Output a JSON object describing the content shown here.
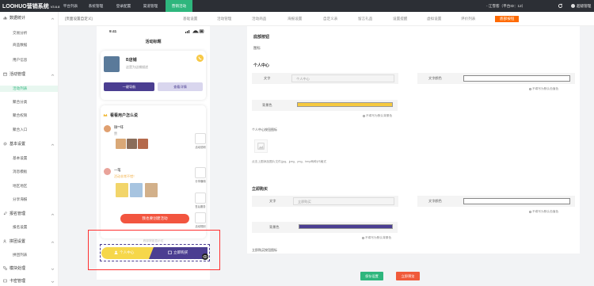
{
  "app": {
    "name": "LOOHUO营销系统",
    "version": "V3.6.8"
  },
  "topbar": {
    "nav": [
      "平台列表",
      "系统管理",
      "登录配置",
      "渠道管理",
      "营销活动"
    ],
    "merchant": "- 江雪客（平台ID：12）",
    "account": "超级管理"
  },
  "sidebar": {
    "groups": [
      {
        "label": "数据统计",
        "items": [
          "交易分析",
          "商品数据",
          "用户信息"
        ]
      },
      {
        "label": "活动管理",
        "items": [
          "活动列表",
          "聚合分类",
          "聚合权限",
          "聚合入口"
        ]
      },
      {
        "label": "基本设置",
        "items": [
          "基本设置",
          "消息模板",
          "地区地区",
          "分享海报"
        ]
      },
      {
        "label": "报名管理",
        "items": [
          "报名设置"
        ]
      },
      {
        "label": "拼团设置",
        "items": [
          "拼团列表"
        ]
      },
      {
        "label": "模块处理",
        "items": []
      },
      {
        "label": "卡密管理",
        "items": []
      }
    ],
    "active_item": "活动列表"
  },
  "tabs": [
    "[页面设置自定义]",
    "基础设置",
    "活动管理",
    "活动商品",
    "海报设置",
    "自定义表",
    "留言礼品",
    "设置提醒",
    "虚拟设置",
    "评价列表",
    "底部按钮"
  ],
  "phone": {
    "time": "9:41",
    "title": "活动标题",
    "shop_name": "B店铺",
    "shop_desc": "这是为店铺描述",
    "btn_nav": "一键导航",
    "btn_detail": "查看详情",
    "say_title": "看看用户怎么说",
    "reviews": [
      {
        "name": "微**啡",
        "text": "赞"
      },
      {
        "name": "一笔",
        "text": "活动非常不错！"
      }
    ],
    "badges": [
      "活动说明",
      "分享赚佣",
      "售后服务",
      "活动规则"
    ],
    "cta": "我也要创建活动",
    "footer_label": "底部按钮显示位",
    "bar_left": "个人中心",
    "bar_right": "立即购买"
  },
  "panel": {
    "title": "底部按钮",
    "icon_label": "图标",
    "personal": {
      "section": "个人中心",
      "text_label": "文字",
      "text_placeholder": "个人中心",
      "text_color_label": "文字颜色",
      "text_color_hint": "不填写为默认色值色",
      "bg_label": "背景色",
      "bg_hint": "不填写为默认背景色",
      "icon_label": "个人中心按钮图标",
      "upload_hint": "点击上图添加图片文件(jpg、jpeg、png、bmp两种)代格式"
    },
    "buy": {
      "section": "立即购买",
      "text_label": "文字",
      "text_placeholder": "立即购买",
      "text_color_label": "文字颜色",
      "text_color_hint": "不填写为默认色值色",
      "bg_label": "背景色",
      "bg_hint": "不填写为默认背景色",
      "icon_label": "立即购买按钮图标"
    }
  },
  "actions": {
    "save": "保存设置",
    "preview": "立即预览"
  },
  "colors": {
    "accent": "#2eb67d",
    "yellow": "#f6c93e",
    "purple": "#4b3e91",
    "orange": "#ff6a00",
    "red": "#f05a3a"
  }
}
